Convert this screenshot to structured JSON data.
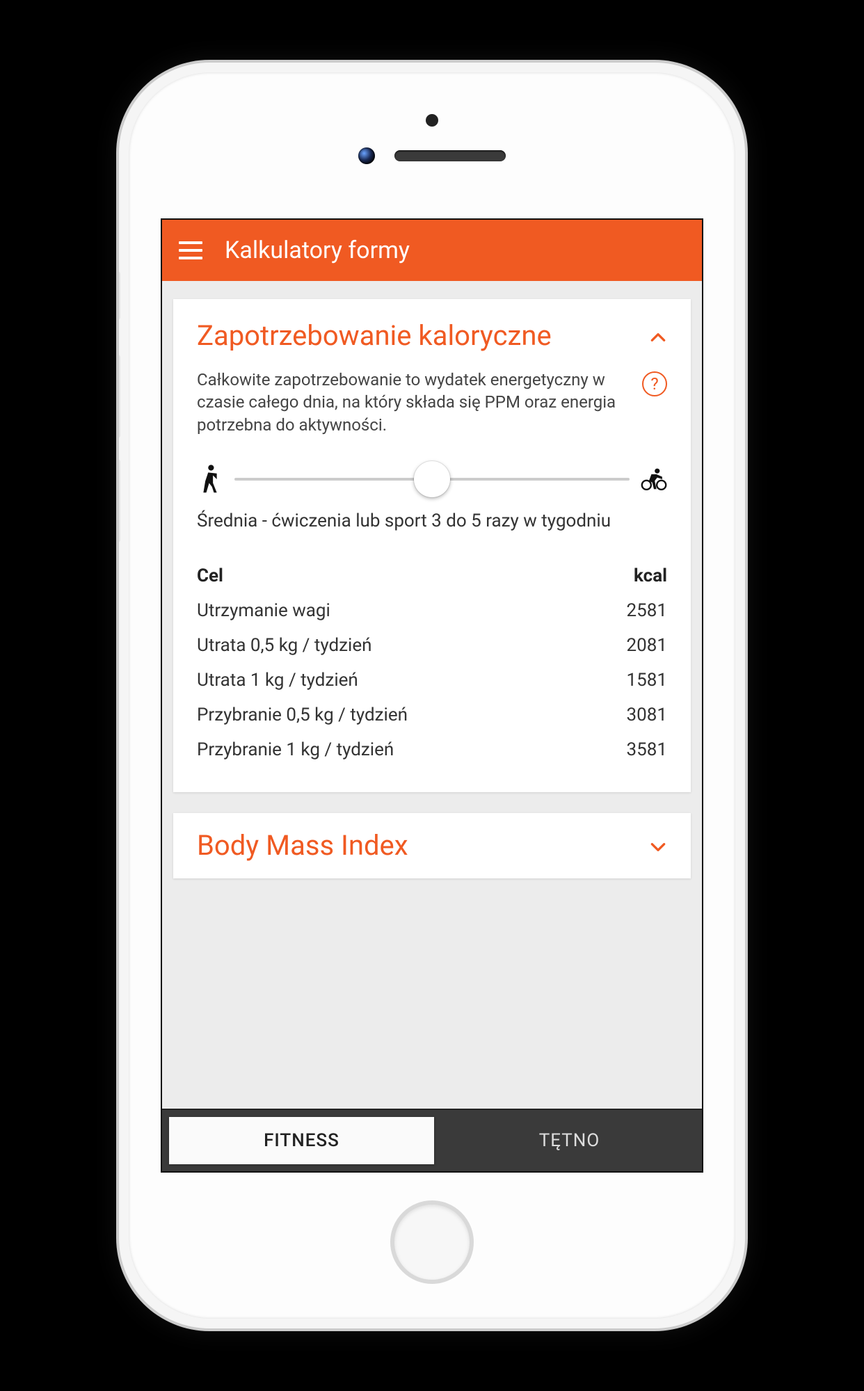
{
  "header": {
    "title": "Kalkulatory formy"
  },
  "card1": {
    "title": "Zapotrzebowanie kaloryczne",
    "description": "Całkowite zapotrzebowanie to wydatek energetyczny w czasie całego dnia, na który składa się PPM oraz energia potrzebna do aktywności.",
    "slider_caption": "Średnia - ćwiczenia lub sport 3 do 5 razy w tygodniu",
    "table": {
      "col1": "Cel",
      "col2": "kcal",
      "rows": [
        {
          "label": "Utrzymanie wagi",
          "value": "2581"
        },
        {
          "label": "Utrata 0,5 kg / tydzień",
          "value": "2081"
        },
        {
          "label": "Utrata 1 kg / tydzień",
          "value": "1581"
        },
        {
          "label": "Przybranie 0,5 kg / tydzień",
          "value": "3081"
        },
        {
          "label": "Przybranie 1 kg / tydzień",
          "value": "3581"
        }
      ]
    }
  },
  "card2": {
    "title": "Body Mass Index"
  },
  "tabs": {
    "fitness": "FITNESS",
    "tetno": "TĘTNO"
  }
}
